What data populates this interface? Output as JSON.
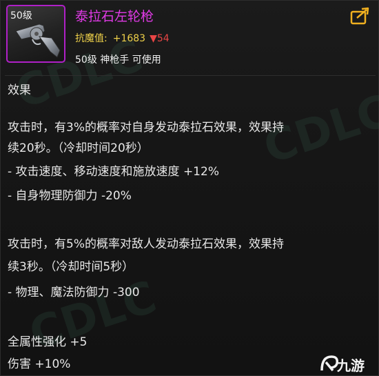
{
  "item": {
    "level_tag": "50级",
    "name": "泰拉石左轮枪",
    "stat_label": "抗魔值:",
    "stat_value": "+1683",
    "stat_diff": "▼54",
    "requirement": "50级 神枪手 可使用"
  },
  "effects": {
    "heading": "效果",
    "effect1_line1": "攻击时，有3%的概率对自身发动泰拉石效果，效果持",
    "effect1_line2": "续20秒。（冷却时间20秒）",
    "effect1_bonus1": " - 攻击速度、移动速度和施放速度 +12%",
    "effect1_bonus2": " - 自身物理防御力 -20%",
    "effect2_line1": "攻击时，有5%的概率对敌人发动泰拉石效果，效果持",
    "effect2_line2": "续3秒。（冷却时间5秒）",
    "effect2_bonus1": " - 物理、魔法防御力 -300",
    "stat1": "全属性强化 +5",
    "stat2": "伤害 +10%"
  },
  "logo": {
    "text": "九游"
  },
  "colors": {
    "name": "#e03ae6",
    "stat": "#f0d24a",
    "down": "#e94545",
    "frame": "#b020c8"
  }
}
